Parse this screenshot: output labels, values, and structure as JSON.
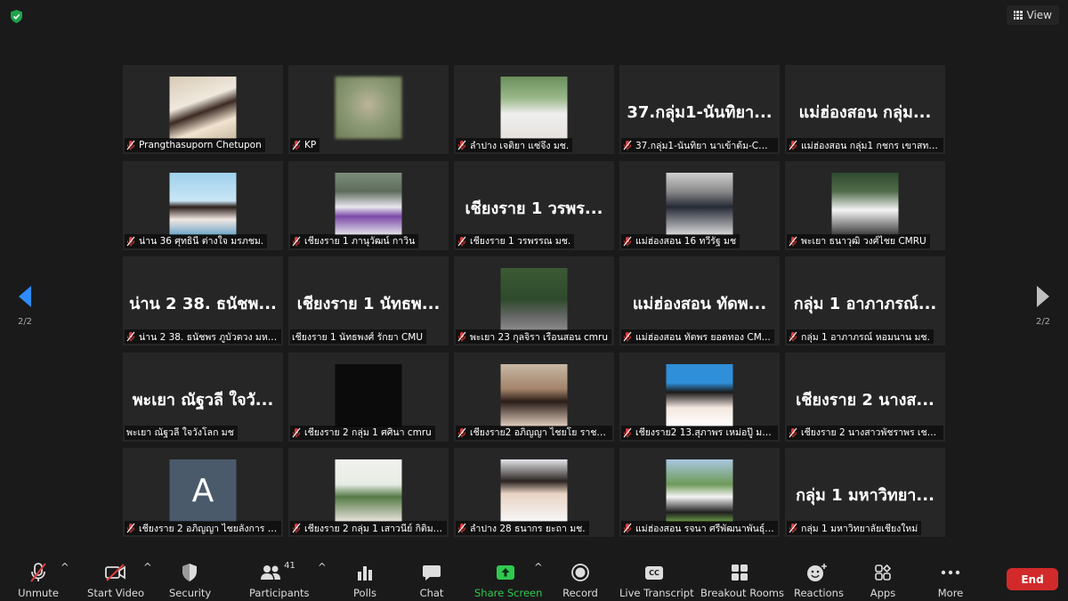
{
  "topbar": {
    "view_label": "View"
  },
  "pagination": {
    "left_page": "2/2",
    "right_page": "2/2"
  },
  "tiles": [
    {
      "label": "Prangthasuporn Chetupon",
      "big": "",
      "photo": "photo-1"
    },
    {
      "label": "KP",
      "big": "",
      "photo": "blur"
    },
    {
      "label": "ลำปาง เจติยา แซ่จึง มช.",
      "big": "",
      "photo": "photo-3"
    },
    {
      "label": "37.กลุ่ม1-นันทิยา นาเข้าต้ม-CM...",
      "big": "37.กลุ่ม1-นันทิยา...",
      "photo": ""
    },
    {
      "label": "แม่ฮ่องสอน กลุ่ม1 กชกร เขาสทไห...",
      "big": "แม่ฮ่องสอน กลุ่ม...",
      "photo": ""
    },
    {
      "label": "น่าน 36 ศุทธินี ต่างใจ มรภชม.",
      "big": "",
      "photo": "photo-6"
    },
    {
      "label": "เชียงราย 1 ภานุวัฒน์ กาวิน",
      "big": "",
      "photo": "photo-7"
    },
    {
      "label": "เชียงราย 1 วรพรรณ มช.",
      "big": "เชียงราย 1 วรพร...",
      "photo": ""
    },
    {
      "label": "แม่ฮ่องสอน 16 ทวีรัฐ มช",
      "big": "",
      "photo": "photo-9"
    },
    {
      "label": "พะเยา ธนาวุฒิ วงศ์ไชย CMRU",
      "big": "",
      "photo": "photo-10"
    },
    {
      "label": "น่าน 2 38. ธนัชพร ภูบัวดวง มหา...",
      "big": "น่าน 2 38. ธนัชพ...",
      "photo": ""
    },
    {
      "label": "เชียงราย 1 นัทธพงศ์ รักยา CMU",
      "big": "เชียงราย 1 นัทธพ...",
      "photo": "",
      "nomic": true
    },
    {
      "label": "พะเยา 23 กุลจิรา เรือนสอน cmru",
      "big": "",
      "photo": "photo-13"
    },
    {
      "label": "แม่ฮ่องสอน ทัตพร ยอดทอง CM...",
      "big": "แม่ฮ่องสอน ทัดพ...",
      "photo": ""
    },
    {
      "label": "กลุ่ม 1 อาภาภรณ์ หอมนาน มช.",
      "big": "กลุ่ม 1 อาภาภรณ์...",
      "photo": ""
    },
    {
      "label": "พะเยา ณัฐวลี ใจวังโลก มช",
      "big": "พะเยา ณัฐวลี ใจวั...",
      "photo": "",
      "nomic": true
    },
    {
      "label": "เชียงราย 2 กลุ่ม 1 ศศินา cmru",
      "big": "",
      "photo": "dark"
    },
    {
      "label": "เชียงราย2 อภิญญา ไชยโย ราชภั...",
      "big": "",
      "photo": "photo-18"
    },
    {
      "label": "เชียงราย2 13.สุภาพร เหม่อปู๊ มหา...",
      "big": "",
      "photo": "photo-19"
    },
    {
      "label": "เชียงราย 2 นางสาวพัชราพร เชอมือ",
      "big": "เชียงราย 2 นางส...",
      "photo": ""
    },
    {
      "label": "เชียงราย 2 อภิญญา ไชยลังการ มช",
      "big": "",
      "photo": "avatar",
      "avatar_letter": "A"
    },
    {
      "label": "เชียงราย 2 กลุ่ม 1 เสาวนีย์ กิติมา ...",
      "big": "",
      "photo": "photo-22"
    },
    {
      "label": "ลำปาง 28 ธนากร ยะถา มช.",
      "big": "",
      "photo": "photo-23"
    },
    {
      "label": "แม่ฮ่องสอน รจนา ศรีพัฒนาพันธุ์เ...",
      "big": "",
      "photo": "photo-24"
    },
    {
      "label": "กลุ่ม 1 มหาวิทยาลัยเชียงใหม่",
      "big": "กลุ่ม 1 มหาวิทยา...",
      "photo": ""
    }
  ],
  "toolbar": {
    "unmute": "Unmute",
    "start_video": "Start Video",
    "security": "Security",
    "participants": "Participants",
    "participants_count": "41",
    "polls": "Polls",
    "chat": "Chat",
    "share_screen": "Share Screen",
    "record": "Record",
    "live_transcript": "Live Transcript",
    "breakout_rooms": "Breakout Rooms",
    "reactions": "Reactions",
    "apps": "Apps",
    "more": "More",
    "end": "End",
    "cc": "CC"
  },
  "colors": {
    "share_green": "#2fc94f",
    "end_red": "#d22a2a",
    "muted_red": "#e03c3c",
    "nav_blue": "#2d8cff"
  }
}
